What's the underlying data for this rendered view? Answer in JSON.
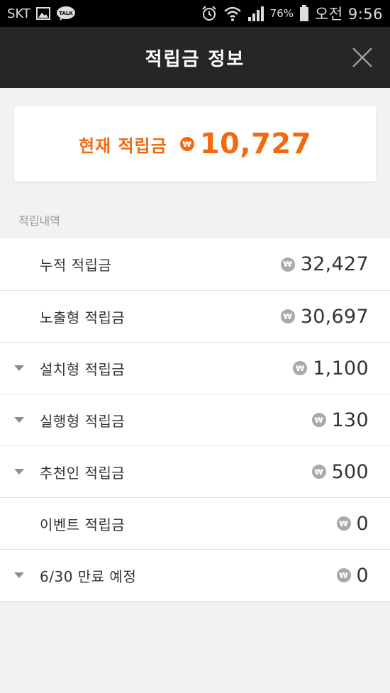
{
  "status_bar": {
    "carrier": "SKT",
    "battery": "76%",
    "time": "오전 9:56",
    "icons": [
      "image-icon",
      "talk-icon",
      "alarm-icon",
      "wifi-icon",
      "signal-icon",
      "battery-icon"
    ]
  },
  "header": {
    "title": "적립금 정보",
    "close_icon": "close-icon"
  },
  "balance": {
    "label": "현재 적립금",
    "currency_symbol": "₩",
    "value": "10,727",
    "accent_color": "#f26a0f"
  },
  "history": {
    "section_label": "적립내역",
    "items": [
      {
        "label": "누적 적립금",
        "value": "32,427",
        "currency_symbol": "₩",
        "expandable": false
      },
      {
        "label": "노출형 적립금",
        "value": "30,697",
        "currency_symbol": "₩",
        "expandable": false
      },
      {
        "label": "설치형 적립금",
        "value": "1,100",
        "currency_symbol": "₩",
        "expandable": true
      },
      {
        "label": "실행형 적립금",
        "value": "130",
        "currency_symbol": "₩",
        "expandable": true
      },
      {
        "label": "추천인 적립금",
        "value": "500",
        "currency_symbol": "₩",
        "expandable": true
      },
      {
        "label": "이벤트 적립금",
        "value": "0",
        "currency_symbol": "₩",
        "expandable": false
      },
      {
        "label": "6/30 만료 예정",
        "value": "0",
        "currency_symbol": "₩",
        "expandable": true
      }
    ]
  }
}
